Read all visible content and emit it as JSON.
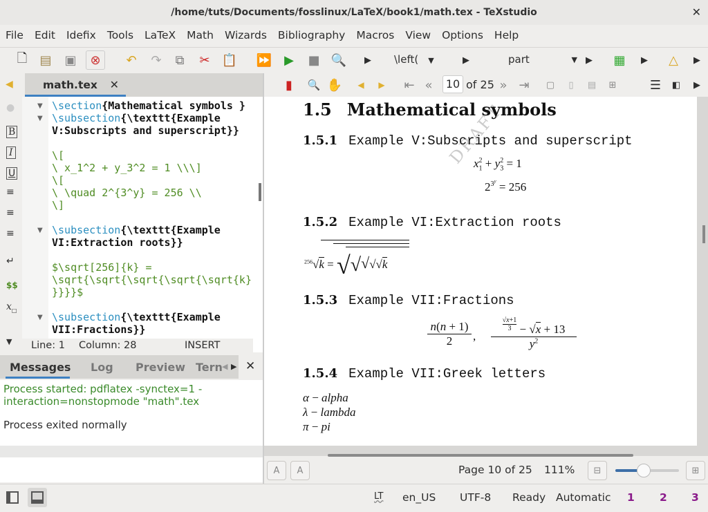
{
  "window": {
    "title": "/home/tuts/Documents/fosslinux/LaTeX/book1/math.tex - TeXstudio",
    "close": "✕"
  },
  "menu": [
    "File",
    "Edit",
    "Idefix",
    "Tools",
    "LaTeX",
    "Math",
    "Wizards",
    "Bibliography",
    "Macros",
    "View",
    "Options",
    "Help"
  ],
  "toolbar": {
    "left_combo": "\\left(",
    "struct_combo": "part"
  },
  "doc_tab": {
    "label": "math.tex",
    "close": "✕"
  },
  "pdf_nav": {
    "page": "10",
    "of": "of 25"
  },
  "editor": {
    "lines": [
      [
        {
          "k": "cmd",
          "t": "\\section"
        },
        {
          "k": "br",
          "t": "{Mathematical symbols }"
        }
      ],
      [
        {
          "k": "cmd",
          "t": "\\subsection"
        },
        {
          "k": "br",
          "t": "{\\texttt{Example"
        }
      ],
      [
        {
          "k": "br",
          "t": "V:Subscripts and superscript}}"
        }
      ],
      [],
      [
        {
          "k": "mth",
          "t": "\\["
        }
      ],
      [
        {
          "k": "mth",
          "t": "\\ x_1^2 + y_3^2 = 1 \\\\\\]"
        }
      ],
      [
        {
          "k": "mth",
          "t": "\\["
        }
      ],
      [
        {
          "k": "mth",
          "t": "\\ \\quad 2^{3^y} = 256 \\\\"
        }
      ],
      [
        {
          "k": "mth",
          "t": "\\]"
        }
      ],
      [],
      [
        {
          "k": "cmd",
          "t": "\\subsection"
        },
        {
          "k": "br",
          "t": "{\\texttt{Example"
        }
      ],
      [
        {
          "k": "br",
          "t": "VI:Extraction roots}}"
        }
      ],
      [],
      [
        {
          "k": "mth",
          "t": "$\\sqrt[256]{k} ="
        }
      ],
      [
        {
          "k": "mth",
          "t": "\\sqrt{\\sqrt{\\sqrt{\\sqrt{\\sqrt{k}"
        }
      ],
      [
        {
          "k": "mth",
          "t": "}}}}$"
        }
      ],
      [],
      [
        {
          "k": "cmd",
          "t": "\\subsection"
        },
        {
          "k": "br",
          "t": "{\\texttt{Example"
        }
      ],
      [
        {
          "k": "br",
          "t": "VII:Fractions}}"
        }
      ]
    ],
    "status": {
      "line": "Line: 1",
      "column": "Column: 28",
      "mode": "INSERT"
    }
  },
  "messages": {
    "tabs": [
      "Messages",
      "Log",
      "Preview",
      "Tern"
    ],
    "close": "✕",
    "started": "Process started: pdflatex -synctex=1 -",
    "started2": "interaction=nonstopmode \"math\".tex",
    "exited": "Process exited normally"
  },
  "pdf": {
    "watermark": "DRAFT",
    "s15": {
      "num": "1.5",
      "title": "Mathematical symbols"
    },
    "s151": {
      "num": "1.5.1",
      "title": "Example V:Subscripts and superscript"
    },
    "s152": {
      "num": "1.5.2",
      "title": "Example VI:Extraction roots"
    },
    "s153": {
      "num": "1.5.3",
      "title": "Example VII:Fractions"
    },
    "s154": {
      "num": "1.5.4",
      "title": "Example VII:Greek letters"
    },
    "greek": [
      {
        "sym": "α",
        "name": "alpha"
      },
      {
        "sym": "λ",
        "name": "lambda"
      },
      {
        "sym": "π",
        "name": "pi"
      }
    ]
  },
  "pdf_status": {
    "page": "Page 10 of 25",
    "zoom": "111%",
    "zoom_slider_fraction": 0.45
  },
  "status": {
    "lt": "LT",
    "lang": "en_US",
    "encoding": "UTF-8",
    "state": "Ready",
    "mode": "Automatic",
    "bookmarks": [
      "1",
      "2",
      "3"
    ]
  },
  "colors": {
    "accent": "#3d80c2",
    "command": "#2c8fc0",
    "math": "#4f8c23",
    "message_green": "#3a8a2a",
    "bookmark": "#8a1a8a"
  }
}
